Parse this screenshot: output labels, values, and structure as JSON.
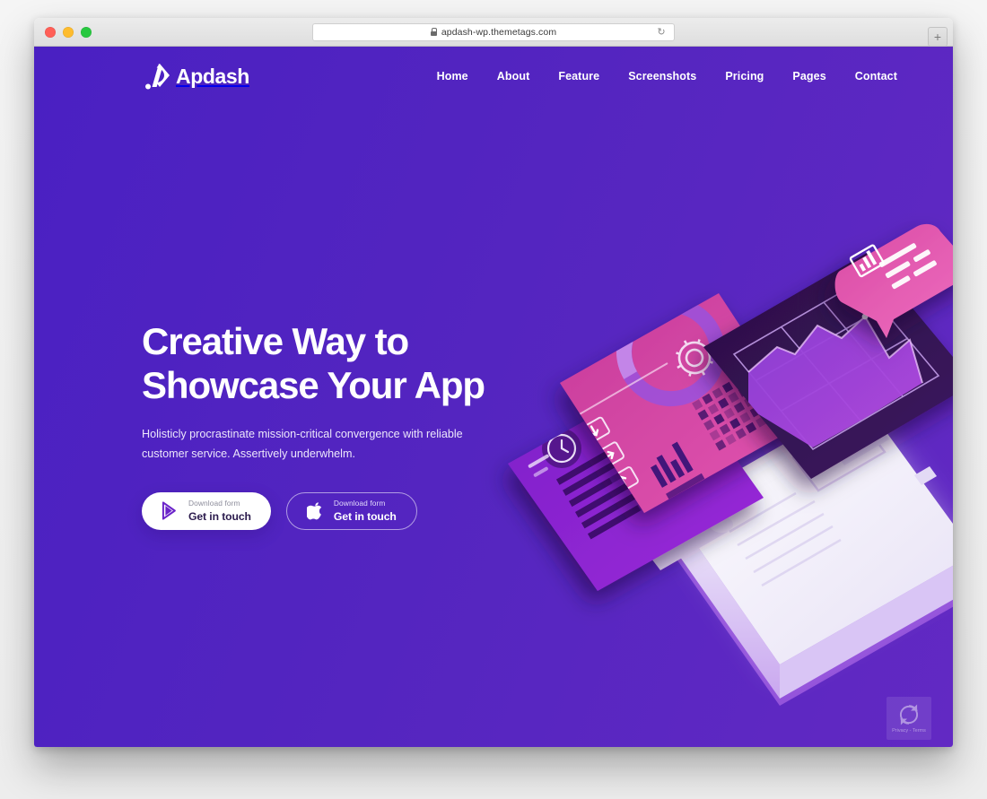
{
  "browser": {
    "url": "apdash-wp.themetags.com",
    "lock_icon": "lock-icon",
    "reload_icon": "↻",
    "newtab_icon": "+",
    "traffic_lights": [
      "close-red",
      "minimize-yellow",
      "maximize-green"
    ]
  },
  "site": {
    "brand": {
      "name": "Apdash",
      "mark_icon": "apdash-logo-icon"
    },
    "nav": [
      {
        "label": "Home"
      },
      {
        "label": "About"
      },
      {
        "label": "Feature"
      },
      {
        "label": "Screenshots"
      },
      {
        "label": "Pricing"
      },
      {
        "label": "Pages"
      },
      {
        "label": "Contact"
      }
    ],
    "hero": {
      "title_line1": "Creative Way to",
      "title_line2": "Showcase Your App",
      "subtitle": "Holisticly procrastinate mission-critical convergence with reliable customer service. Assertively underwhelm.",
      "buttons": [
        {
          "icon": "google-play-icon",
          "small_label": "Download form",
          "big_label": "Get in touch",
          "style": "filled"
        },
        {
          "icon": "apple-icon",
          "small_label": "Download form",
          "big_label": "Get in touch",
          "style": "outlined"
        }
      ],
      "illustration": {
        "name": "isometric-app-dashboard-illustration",
        "elements": [
          "white-smartphone",
          "dark-purple-area-chart-card",
          "pink-analytics-card-with-gear",
          "purple-bar-list-card",
          "pink-tooltip-bubble-with-chart-icon"
        ]
      }
    },
    "recaptcha": {
      "text": "Privacy - Terms",
      "logo_icon": "recaptcha-icon"
    },
    "colors": {
      "bg_left": "#4A20C2",
      "bg_right": "#6229C3",
      "accent_pink": "#D9439C",
      "card_dark": "#2B1047",
      "card_purple": "#8A28D8",
      "text_on_dark": "#FFFFFF"
    }
  }
}
